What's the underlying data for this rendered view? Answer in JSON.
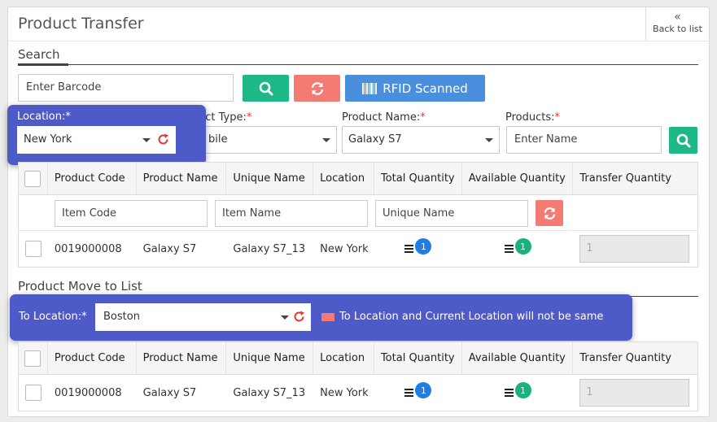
{
  "header": {
    "title": "Product Transfer",
    "back_icon": "«",
    "back_label": "Back to list"
  },
  "search": {
    "section_title": "Search",
    "barcode_placeholder": "Enter Barcode",
    "rfid_label": "RFID Scanned",
    "location_label": "Location:",
    "location_value": "New York",
    "product_type_label": "uct Type:",
    "product_type_value": "bile",
    "product_name_label": "Product Name:",
    "product_name_value": "Galaxy S7",
    "products_label": "Products:",
    "products_placeholder": "Enter Name",
    "required_mark": "*"
  },
  "table_headers": [
    "Product Code",
    "Product Name",
    "Unique Name",
    "Location",
    "Total Quantity",
    "Available Quantity",
    "Transfer Quantity"
  ],
  "filters": {
    "item_code": "Item Code",
    "item_name": "Item Name",
    "unique_name": "Unique Name"
  },
  "search_rows": [
    {
      "code": "0019000008",
      "name": "Galaxy S7",
      "unique": "Galaxy S7_13",
      "location": "New York",
      "total": "1",
      "available": "1",
      "transfer": "1"
    }
  ],
  "move": {
    "section_title": "Product Move to List",
    "to_location_label": "To Location:*",
    "to_location_value": "Boston",
    "warning": "To Location and Current Location will not be same"
  },
  "move_rows": [
    {
      "code": "0019000008",
      "name": "Galaxy S7",
      "unique": "Galaxy S7_13",
      "location": "New York",
      "total": "1",
      "available": "1",
      "transfer": "1"
    }
  ],
  "colors": {
    "accent_green": "#1eb886",
    "accent_red": "#f47a74",
    "accent_blue": "#4a8fde",
    "callout": "#4e5ac7"
  }
}
